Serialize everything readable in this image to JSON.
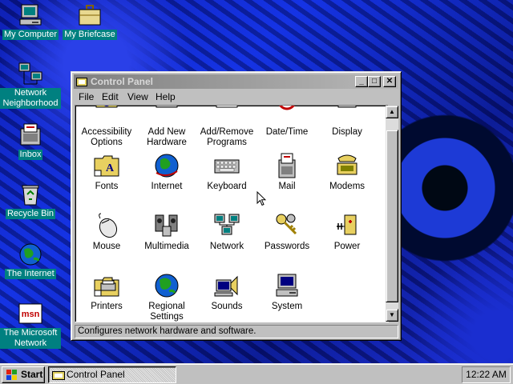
{
  "desktop": {
    "icons": [
      {
        "label": "My Computer",
        "icon": "my-computer-icon"
      },
      {
        "label": "My Briefcase",
        "icon": "briefcase-icon"
      },
      {
        "label": "Network Neighborhood",
        "icon": "network-neighborhood-icon"
      },
      {
        "label": "Inbox",
        "icon": "inbox-icon"
      },
      {
        "label": "Recycle Bin",
        "icon": "recycle-bin-icon"
      },
      {
        "label": "The Internet",
        "icon": "internet-icon"
      },
      {
        "label": "The Microsoft Network",
        "icon": "msn-icon"
      }
    ]
  },
  "window": {
    "title": "Control Panel",
    "menu": [
      "File",
      "Edit",
      "View",
      "Help"
    ],
    "items": [
      {
        "label": "Accessibility Options",
        "icon": "accessibility-icon"
      },
      {
        "label": "Add New Hardware",
        "icon": "add-hardware-icon"
      },
      {
        "label": "Add/Remove Programs",
        "icon": "add-remove-programs-icon"
      },
      {
        "label": "Date/Time",
        "icon": "clock-icon"
      },
      {
        "label": "Display",
        "icon": "display-icon"
      },
      {
        "label": "Fonts",
        "icon": "fonts-folder-icon"
      },
      {
        "label": "Internet",
        "icon": "globe-icon"
      },
      {
        "label": "Keyboard",
        "icon": "keyboard-icon"
      },
      {
        "label": "Mail",
        "icon": "mail-icon"
      },
      {
        "label": "Modems",
        "icon": "modem-icon"
      },
      {
        "label": "Mouse",
        "icon": "mouse-icon"
      },
      {
        "label": "Multimedia",
        "icon": "multimedia-icon"
      },
      {
        "label": "Network",
        "icon": "network-icon"
      },
      {
        "label": "Passwords",
        "icon": "keys-icon"
      },
      {
        "label": "Power",
        "icon": "power-icon"
      },
      {
        "label": "Printers",
        "icon": "printers-folder-icon"
      },
      {
        "label": "Regional Settings",
        "icon": "globe-icon"
      },
      {
        "label": "Sounds",
        "icon": "sounds-icon"
      },
      {
        "label": "System",
        "icon": "system-icon"
      }
    ],
    "status": "Configures network hardware and software."
  },
  "taskbar": {
    "start_label": "Start",
    "task_label": "Control Panel",
    "clock": "12:22 AM"
  }
}
